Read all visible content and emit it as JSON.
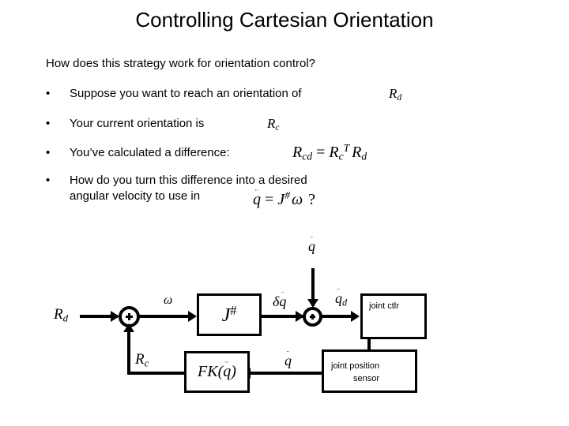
{
  "slide": {
    "title": "Controlling Cartesian Orientation",
    "lead_question": "How does this strategy work for orientation control?",
    "bullets": [
      {
        "marker": "•",
        "text": "Suppose you want to reach an orientation of",
        "math": "R_d"
      },
      {
        "marker": "•",
        "text": "Your current orientation is",
        "math": "R_c"
      },
      {
        "marker": "•",
        "text": "You’ve calculated a difference:",
        "math": "R_cd = R_c^T R_d"
      },
      {
        "marker": "•",
        "text_line1": "How do you turn this difference into a desired",
        "text_line2": "angular velocity to use in",
        "math": "q̇ = J^# ω",
        "trailing": "?"
      }
    ]
  },
  "equations": {
    "eq_rcd": {
      "lhs_base": "R",
      "lhs_sub": "cd",
      "eq": "=",
      "rhs1_base": "R",
      "rhs1_sub": "c",
      "rhs1_sup": "T",
      "rhs2_base": "R",
      "rhs2_sub": "d"
    },
    "eq_qdot": {
      "lhs": "q",
      "lhs_dot": "¨",
      "eq": "=",
      "rhs_base": "J",
      "rhs_sup": "#",
      "omega": "ω",
      "question": "?"
    },
    "rd_label": {
      "base": "R",
      "sub": "d"
    },
    "rc_label": {
      "base": "R",
      "sub": "c"
    }
  },
  "diagram": {
    "name": "cartesian-orientation-control-block-diagram",
    "signals": {
      "input_rd": {
        "base": "R",
        "sub": "d"
      },
      "feedback_rc": {
        "base": "R",
        "sub": "c"
      },
      "omega": "ω",
      "delta_qdot": {
        "delta": "δ",
        "base": "q",
        "dot": "¨"
      },
      "qdot_top": {
        "base": "q",
        "dot": "¨"
      },
      "qdot_desired": {
        "base": "q",
        "dot": "¨",
        "sub": "d"
      },
      "qdot_feedback": {
        "base": "q",
        "dot": "¨"
      }
    },
    "blocks": [
      {
        "id": "jacobian-pinv",
        "base": "J",
        "sup": "#"
      },
      {
        "id": "forward-kinematics",
        "prefix": "FK(",
        "base": "q",
        "dot": "¨",
        "suffix": ")"
      },
      {
        "id": "joint-controller",
        "label": "joint ctlr"
      },
      {
        "id": "joint-position-sensor",
        "label_line1": "joint position",
        "label_line2": "sensor"
      }
    ],
    "summing_junctions": [
      {
        "id": "orientation-error-sum",
        "symbol": "+"
      },
      {
        "id": "velocity-sum",
        "symbol": "+"
      }
    ]
  },
  "colors": {
    "background": "#ffffff",
    "foreground": "#000000"
  }
}
